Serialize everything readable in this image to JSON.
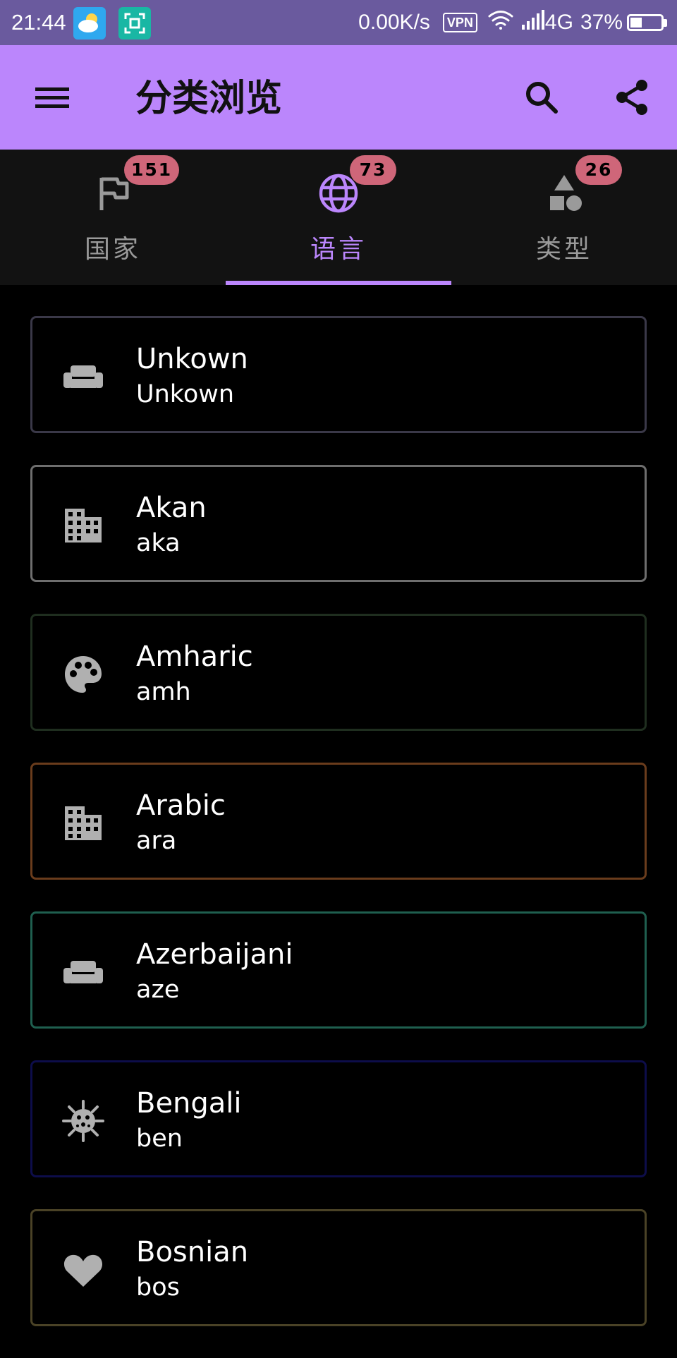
{
  "status_bar": {
    "time": "21:44",
    "net_speed": "0.00K/s",
    "vpn_label": "VPN",
    "network": "4G",
    "battery": "37%",
    "battery_level": 0.37
  },
  "app_bar": {
    "title": "分类浏览",
    "menu_icon": "menu-icon",
    "search_icon": "search-icon",
    "share_icon": "share-icon"
  },
  "tabs": [
    {
      "label": "国家",
      "badge": "151",
      "icon": "flag-icon",
      "active": false
    },
    {
      "label": "语言",
      "badge": "73",
      "icon": "globe-icon",
      "active": true
    },
    {
      "label": "类型",
      "badge": "26",
      "icon": "shapes-icon",
      "active": false
    }
  ],
  "items": [
    {
      "name": "Unkown",
      "code": "Unkown",
      "icon": "sofa-icon",
      "border_color": "#3a3848"
    },
    {
      "name": "Akan",
      "code": "aka",
      "icon": "building-icon",
      "border_color": "#6e6e6e"
    },
    {
      "name": "Amharic",
      "code": "amh",
      "icon": "palette-icon",
      "border_color": "#1f2e1f"
    },
    {
      "name": "Arabic",
      "code": "ara",
      "icon": "building-icon",
      "border_color": "#6a3c1c"
    },
    {
      "name": "Azerbaijani",
      "code": "aze",
      "icon": "sofa-icon",
      "border_color": "#1f5f4f"
    },
    {
      "name": "Bengali",
      "code": "ben",
      "icon": "virus-icon",
      "border_color": "#0d0d4a"
    },
    {
      "name": "Bosnian",
      "code": "bos",
      "icon": "heart-icon",
      "border_color": "#4a4226"
    }
  ],
  "colors": {
    "status_bar": "#6a5a9e",
    "app_bar": "#bb86fc",
    "tab_background": "#121212",
    "accent": "#bb86fc",
    "badge": "#cf6679",
    "icon_grey": "#b0b0b0"
  }
}
